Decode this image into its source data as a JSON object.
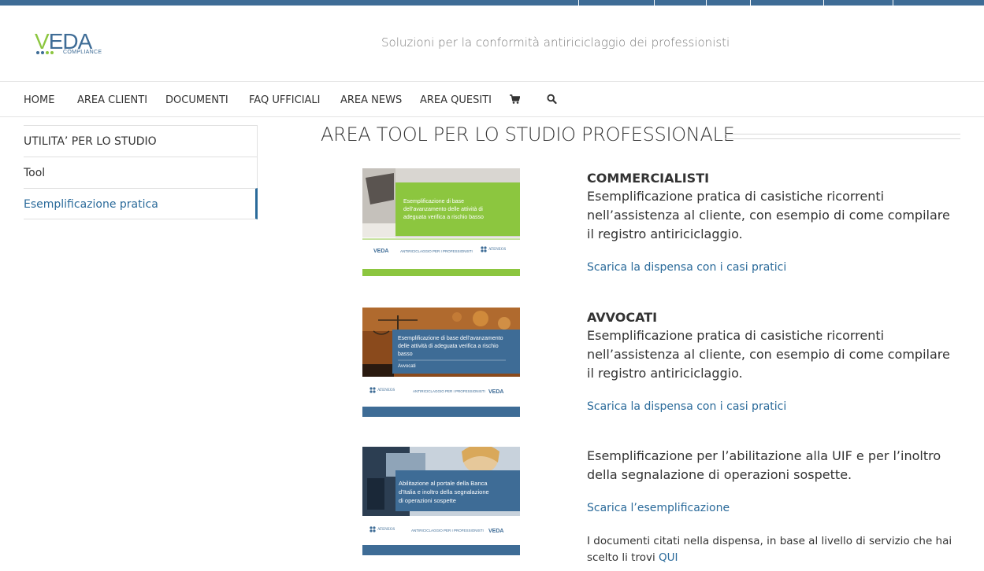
{
  "brand": {
    "logo_word": "VEDA",
    "logo_sub": "COMPLIANCE",
    "tagline": "Soluzioni per la conformità antiriciclaggio dei professionisti",
    "colors": {
      "blue": "#3e6c96",
      "green": "#8cc63f",
      "link": "#2a6a9a"
    }
  },
  "nav": {
    "items": [
      "HOME",
      "AREA CLIENTI",
      "DOCUMENTI",
      "FAQ UFFICIALI",
      "AREA NEWS",
      "AREA QUESITI"
    ],
    "icons": [
      "shopping-cart-icon",
      "search-icon"
    ]
  },
  "sidebar": {
    "items": [
      {
        "label": "UTILITA’ PER LO STUDIO",
        "active": false
      },
      {
        "label": "Tool",
        "active": false
      },
      {
        "label": "Esemplificazione pratica",
        "active": true
      }
    ]
  },
  "main": {
    "title": "AREA TOOL PER LO STUDIO PROFESSIONALE",
    "cards": [
      {
        "title": "COMMERCIALISTI",
        "desc": "Esemplificazione pratica di casistiche ricorrenti nell’assistenza al cliente, con esempio di come compilare il registro antiriciclaggio.",
        "link": "Scarica la dispensa con i casi pratici",
        "thumb": {
          "text": "Esemplificazione di base dell’avanzamento delle attività di adeguata verifica a rischio basso",
          "footer": "ANTIRICICLAGGIO PER I PROFESSIONISTI",
          "logo_left": "VEDA",
          "logo_right": "ATENEOS"
        }
      },
      {
        "title": "AVVOCATI",
        "desc": "Esemplificazione pratica di casistiche ricorrenti nell’assistenza al cliente, con esempio di come compilare il registro antiriciclaggio.",
        "link": "Scarica la dispensa con i casi pratici",
        "thumb": {
          "text": "Esemplificazione di base dell’avanzamento delle attività di adeguata verifica a rischio basso",
          "subtitle": "Avvocati",
          "footer": "ANTIRICICLAGGIO PER I PROFESSIONISTI",
          "logo_left": "ATENEOS",
          "logo_right": "VEDA"
        }
      },
      {
        "title": "",
        "desc": "Esemplificazione per l’abilitazione alla UIF e per l’inoltro della segnalazione di operazioni sospette.",
        "link": "Scarica l’esemplificazione",
        "thumb": {
          "text": "Abilitazione al portale della Banca d’Italia e inoltro della segnalazione di operazioni sospette",
          "footer": "ANTIRICICLAGGIO PER I PROFESSIONISTI",
          "logo_left": "ATENEOS",
          "logo_right": "VEDA"
        }
      }
    ],
    "note_text": "I documenti citati nella dispensa, in base al livello di servizio che hai scelto li trovi",
    "note_link": "QUI"
  }
}
